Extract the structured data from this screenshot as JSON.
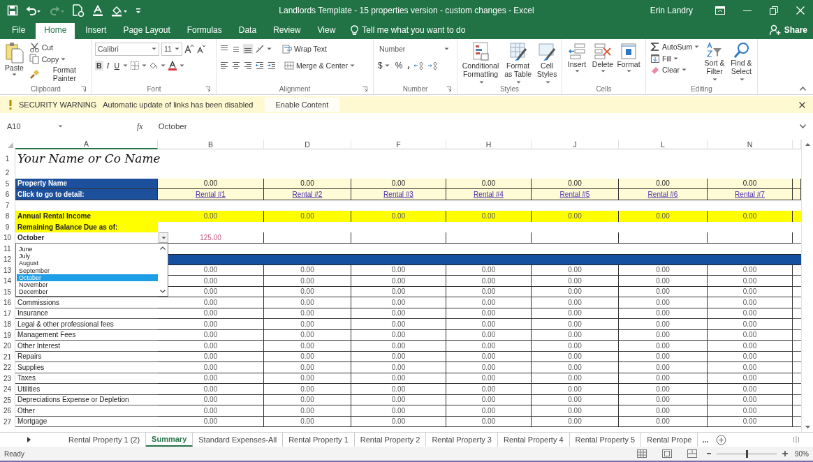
{
  "title_bar": {
    "title": "Landlords Template - 15 properties version - custom changes - Excel",
    "user": "Erin Landry"
  },
  "ribbon_tabs": [
    {
      "label": "File",
      "selected": false
    },
    {
      "label": "Home",
      "selected": true
    },
    {
      "label": "Insert",
      "selected": false
    },
    {
      "label": "Page Layout",
      "selected": false
    },
    {
      "label": "Formulas",
      "selected": false
    },
    {
      "label": "Data",
      "selected": false
    },
    {
      "label": "Review",
      "selected": false
    },
    {
      "label": "View",
      "selected": false
    }
  ],
  "tell_me": "Tell me what you want to do",
  "share": "Share",
  "ribbon": {
    "clipboard": {
      "label": "Clipboard",
      "paste": "Paste",
      "cut": "Cut",
      "copy": "Copy",
      "format_painter": "Format Painter"
    },
    "font": {
      "label": "Font",
      "name": "Calibri",
      "size": "11",
      "bold": "B",
      "italic": "I",
      "underline": "U"
    },
    "alignment": {
      "label": "Alignment",
      "wrap_text": "Wrap Text",
      "merge": "Merge & Center"
    },
    "number": {
      "label": "Number",
      "format": "Number",
      "currency": "$",
      "percent": "%"
    },
    "styles": {
      "label": "Styles",
      "buttons": [
        "Conditional Formatting",
        "Format as Table",
        "Cell Styles"
      ]
    },
    "cells": {
      "label": "Cells",
      "buttons": [
        "Insert",
        "Delete",
        "Format"
      ]
    },
    "editing": {
      "label": "Editing",
      "autosum": "AutoSum",
      "fill": "Fill",
      "clear": "Clear",
      "sort": "Sort & Filter",
      "find": "Find & Select"
    }
  },
  "security_bar": {
    "title": "SECURITY WARNING",
    "message": "Automatic update of links has been disabled",
    "button": "Enable Content"
  },
  "formula_bar": {
    "name_box": "A10",
    "function_label": "fx",
    "value": "October"
  },
  "sheet": {
    "columns": [
      "A",
      "B",
      "D",
      "F",
      "H",
      "J",
      "L",
      "N"
    ],
    "rows": [
      {
        "number": "1",
        "kind": "title",
        "label": "Your Name or Co Name"
      },
      {
        "number": "2",
        "kind": "blank"
      },
      {
        "number": "5",
        "kind": "header",
        "label": "Property Name",
        "values": [
          "0.00",
          "0.00",
          "0.00",
          "0.00",
          "0.00",
          "0.00",
          "0.00"
        ]
      },
      {
        "number": "6",
        "kind": "links",
        "label": "Click to go to detail:",
        "values": [
          "Rental #1",
          "Rental #2",
          "Rental #3",
          "Rental #4",
          "Rental #5",
          "Rental #6",
          "Rental #7"
        ]
      },
      {
        "number": "7",
        "kind": "blank"
      },
      {
        "number": "8",
        "kind": "highlight",
        "label": "Annual Rental Income",
        "values": [
          "0.00",
          "0.00",
          "0.00",
          "0.00",
          "0.00",
          "0.00",
          "0.00"
        ]
      },
      {
        "number": "9",
        "kind": "note",
        "label": "Remaining Balance Due as of:"
      },
      {
        "number": "10",
        "kind": "input",
        "label": "October",
        "values": [
          "125.00"
        ]
      },
      {
        "number": "11",
        "kind": "blank"
      },
      {
        "number": "12",
        "kind": "band"
      },
      {
        "number": "13",
        "kind": "data",
        "values": [
          "0.00",
          "0.00",
          "0.00",
          "0.00",
          "0.00",
          "0.00",
          "0.00"
        ]
      },
      {
        "number": "14",
        "kind": "data",
        "values": [
          "0.00",
          "0.00",
          "0.00",
          "0.00",
          "0.00",
          "0.00",
          "0.00"
        ]
      },
      {
        "number": "15",
        "kind": "data",
        "values": [
          "0.00",
          "0.00",
          "0.00",
          "0.00",
          "0.00",
          "0.00",
          "0.00"
        ]
      },
      {
        "number": "16",
        "kind": "data",
        "label": "Commissions",
        "values": [
          "0.00",
          "0.00",
          "0.00",
          "0.00",
          "0.00",
          "0.00",
          "0.00"
        ]
      },
      {
        "number": "17",
        "kind": "data",
        "label": "Insurance",
        "values": [
          "0.00",
          "0.00",
          "0.00",
          "0.00",
          "0.00",
          "0.00",
          "0.00"
        ]
      },
      {
        "number": "18",
        "kind": "data",
        "label": "Legal & other professional fees",
        "values": [
          "0.00",
          "0.00",
          "0.00",
          "0.00",
          "0.00",
          "0.00",
          "0.00"
        ]
      },
      {
        "number": "19",
        "kind": "data",
        "label": "Management Fees",
        "values": [
          "0.00",
          "0.00",
          "0.00",
          "0.00",
          "0.00",
          "0.00",
          "0.00"
        ]
      },
      {
        "number": "20",
        "kind": "data",
        "label": "Other Interest",
        "values": [
          "0.00",
          "0.00",
          "0.00",
          "0.00",
          "0.00",
          "0.00",
          "0.00"
        ]
      },
      {
        "number": "21",
        "kind": "data",
        "label": "Repairs",
        "values": [
          "0.00",
          "0.00",
          "0.00",
          "0.00",
          "0.00",
          "0.00",
          "0.00"
        ]
      },
      {
        "number": "22",
        "kind": "data",
        "label": "Supplies",
        "values": [
          "0.00",
          "0.00",
          "0.00",
          "0.00",
          "0.00",
          "0.00",
          "0.00"
        ]
      },
      {
        "number": "23",
        "kind": "data",
        "label": "Taxes",
        "values": [
          "0.00",
          "0.00",
          "0.00",
          "0.00",
          "0.00",
          "0.00",
          "0.00"
        ]
      },
      {
        "number": "24",
        "kind": "data",
        "label": "Utilities",
        "values": [
          "0.00",
          "0.00",
          "0.00",
          "0.00",
          "0.00",
          "0.00",
          "0.00"
        ]
      },
      {
        "number": "25",
        "kind": "data",
        "label": "Depreciations Expense or Depletion",
        "values": [
          "0.00",
          "0.00",
          "0.00",
          "0.00",
          "0.00",
          "0.00",
          "0.00"
        ]
      },
      {
        "number": "26",
        "kind": "data",
        "label": "Other",
        "values": [
          "0.00",
          "0.00",
          "0.00",
          "0.00",
          "0.00",
          "0.00",
          "0.00"
        ]
      },
      {
        "number": "27",
        "kind": "data",
        "label": "Mortgage",
        "values": [
          "0.00",
          "0.00",
          "0.00",
          "0.00",
          "0.00",
          "0.00",
          "0.00"
        ]
      }
    ],
    "dropdown": {
      "options": [
        {
          "label": "June",
          "selected": false
        },
        {
          "label": "July",
          "selected": false
        },
        {
          "label": "August",
          "selected": false
        },
        {
          "label": "September",
          "selected": false
        },
        {
          "label": "October",
          "selected": true
        },
        {
          "label": "November",
          "selected": false
        },
        {
          "label": "December",
          "selected": false
        }
      ]
    }
  },
  "sheet_tabs": [
    {
      "label": "Rental Property 1 (2)",
      "selected": false
    },
    {
      "label": "Summary",
      "selected": true
    },
    {
      "label": "Standard Expenses-All",
      "selected": false
    },
    {
      "label": "Rental Property 1",
      "selected": false
    },
    {
      "label": "Rental Property 2",
      "selected": false
    },
    {
      "label": "Rental Property 3",
      "selected": false
    },
    {
      "label": "Rental Property 4",
      "selected": false
    },
    {
      "label": "Rental Property 5",
      "selected": false
    },
    {
      "label": "Rental Prope",
      "selected": false
    }
  ],
  "more_tabs": "...",
  "status_bar": {
    "status": "Ready",
    "zoom": "90%",
    "zoom_slider": {
      "level": 0.5
    }
  }
}
